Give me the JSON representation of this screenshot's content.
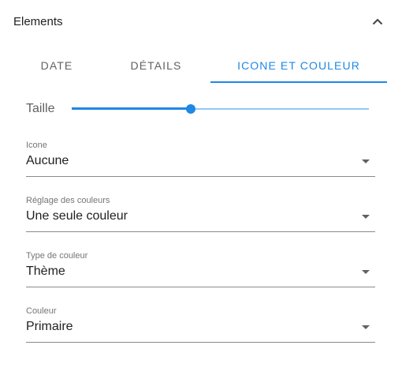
{
  "header": {
    "title": "Elements",
    "collapse_icon": "chevron-up-icon"
  },
  "tabs": [
    {
      "label": "DATE",
      "active": false
    },
    {
      "label": "DÉTAILS",
      "active": false
    },
    {
      "label": "ICONE ET COULEUR",
      "active": true
    }
  ],
  "slider": {
    "label": "Taille",
    "value_fraction": 0.4
  },
  "fields": [
    {
      "label": "Icone",
      "value": "Aucune"
    },
    {
      "label": "Réglage des couleurs",
      "value": "Une seule couleur"
    },
    {
      "label": "Type de couleur",
      "value": "Thème"
    },
    {
      "label": "Couleur",
      "value": "Primaire"
    }
  ],
  "colors": {
    "accent": "#1e88e5",
    "track": "#90caf9"
  }
}
